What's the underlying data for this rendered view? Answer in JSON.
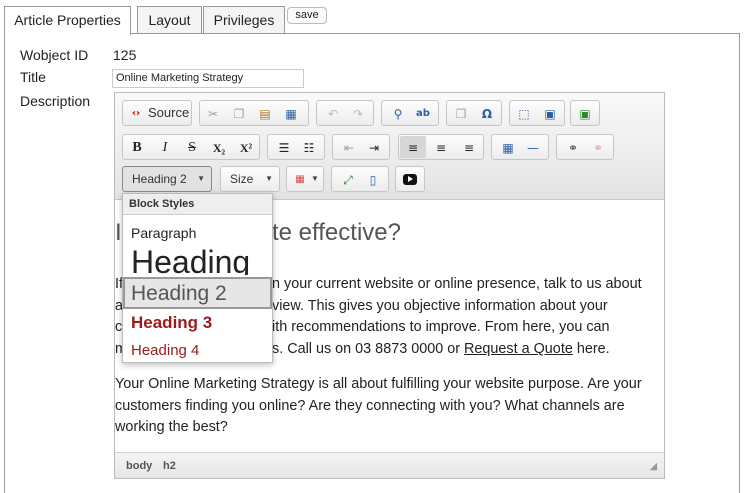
{
  "tabs": [
    {
      "label": "Article Properties",
      "active": true
    },
    {
      "label": "Layout",
      "active": false
    },
    {
      "label": "Privileges",
      "active": false
    }
  ],
  "save_label": "save",
  "form": {
    "wobject_id_label": "Wobject ID",
    "wobject_id_value": "125",
    "title_label": "Title",
    "title_value": "Online Marketing Strategy",
    "description_label": "Description"
  },
  "toolbar": {
    "source_label": "Source",
    "format_value": "Heading 2",
    "size_value": "Size",
    "icons": {
      "row1": [
        "source-icon",
        "cut-icon",
        "copy-icon",
        "paste-icon",
        "paste-word-icon",
        "undo-icon",
        "redo-icon",
        "find-icon",
        "replace-icon",
        "select-all-icon",
        "special-char-icon",
        "maximize-icon",
        "image-icon",
        "insert-icon"
      ],
      "row2": [
        "bold-icon",
        "italic-icon",
        "strike-icon",
        "subscript-icon",
        "superscript-icon",
        "numbered-list-icon",
        "bulleted-list-icon",
        "outdent-icon",
        "indent-icon",
        "align-left-icon",
        "align-center-icon",
        "align-right-icon",
        "table-icon",
        "horizontal-rule-icon",
        "link-icon",
        "unlink-icon"
      ],
      "row3": [
        "color-icon",
        "fullscreen-icon",
        "show-blocks-icon",
        "youtube-icon"
      ]
    }
  },
  "content": {
    "heading_visible": "I",
    "heading_tail": "te effective?",
    "para1_start": "If",
    "para1_line1": "n your current website or online presence, talk to us about",
    "para1_l2_start": "a",
    "para1_line2": "view.  This gives you objective information about your",
    "para1_l3_start": "c",
    "para1_line3": "ith recommendations to improve.  From here, you can",
    "para1_l4_start": "m",
    "para1_line4": "s.  Call us on 03 8873 0000 or ",
    "para1_link": "Request a Quote",
    "para1_end": " here.",
    "para2": "Your Online Marketing Strategy is all about fulfilling your website purpose.  Are your customers finding you online?  Are they connecting with you?  What channels are working the best?"
  },
  "statusbar": [
    "body",
    "h2"
  ],
  "dropdown": {
    "header": "Block Styles",
    "items": [
      {
        "label": "Paragraph"
      },
      {
        "label": "Heading"
      },
      {
        "label": "Heading 2",
        "selected": true
      },
      {
        "label": "Heading 3"
      },
      {
        "label": "Heading 4"
      }
    ]
  },
  "colors": {
    "accent_red": "#9b1b1b",
    "link": "#222",
    "toolbar_bg": "#ebebeb"
  }
}
